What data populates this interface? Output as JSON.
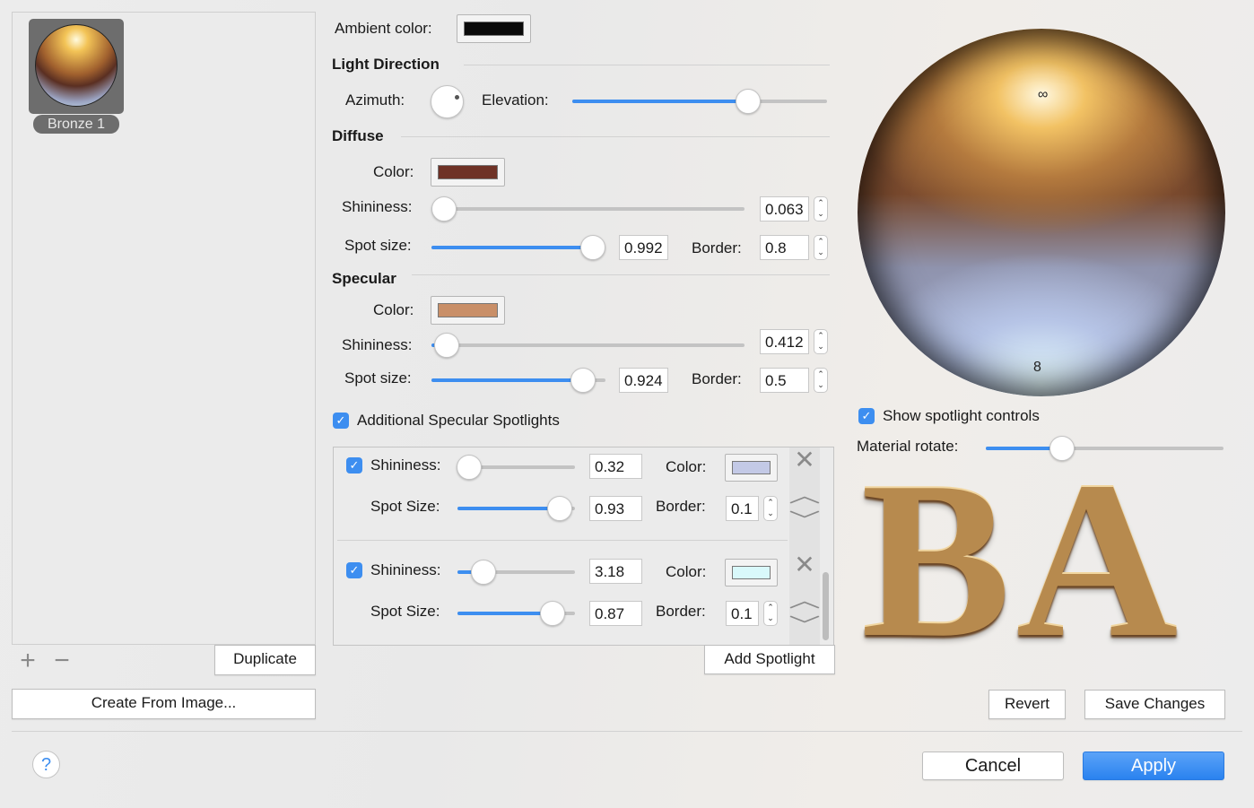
{
  "materials": {
    "items": [
      {
        "label": "Bronze 1"
      }
    ],
    "add_icon": "plus-icon",
    "remove_icon": "minus-icon",
    "duplicate": "Duplicate",
    "create_from_image": "Create From Image..."
  },
  "ambient": {
    "label": "Ambient color:",
    "color": "#0a0a0a"
  },
  "light_direction": {
    "title": "Light Direction",
    "azimuth_label": "Azimuth:",
    "elevation_label": "Elevation:",
    "elevation": 0.69
  },
  "diffuse": {
    "title": "Diffuse",
    "color_label": "Color:",
    "color": "#6e3226",
    "shininess_label": "Shininess:",
    "shininess_slider": 0.04,
    "shininess": "0.063",
    "spot_label": "Spot size:",
    "spot_slider": 0.93,
    "spot": "0.992",
    "border_label": "Border:",
    "border": "0.8"
  },
  "specular": {
    "title": "Specular",
    "color_label": "Color:",
    "color": "#c98f68",
    "shininess_label": "Shininess:",
    "shininess_slider": 0.05,
    "shininess": "0.412",
    "spot_label": "Spot size:",
    "spot_slider": 0.87,
    "spot": "0.924",
    "border_label": "Border:",
    "border": "0.5"
  },
  "additional": {
    "label": "Additional Specular Spotlights",
    "checked": true,
    "spotlights": [
      {
        "checked": true,
        "shininess_label": "Shininess:",
        "shininess_slider": 0.1,
        "shininess": "0.32",
        "color_label": "Color:",
        "color": "#c3c9e6",
        "spot_label": "Spot Size:",
        "spot_slider": 0.87,
        "spot": "0.93",
        "border_label": "Border:",
        "border": "0.1"
      },
      {
        "checked": true,
        "shininess_label": "Shininess:",
        "shininess_slider": 0.22,
        "shininess": "3.18",
        "color_label": "Color:",
        "color": "#d9f9fb",
        "spot_label": "Spot Size:",
        "spot_slider": 0.81,
        "spot": "0.87",
        "border_label": "Border:",
        "border": "0.1"
      }
    ],
    "add_spotlight": "Add Spotlight"
  },
  "preview": {
    "show_spotlight_label": "Show spotlight controls",
    "show_spotlight_checked": true,
    "rotate_label": "Material rotate:",
    "rotate": 0.32,
    "sample_text": "BA",
    "revert": "Revert",
    "save": "Save Changes"
  },
  "footer": {
    "help": "?",
    "cancel": "Cancel",
    "apply": "Apply",
    "accent": "#3d8ef0"
  }
}
